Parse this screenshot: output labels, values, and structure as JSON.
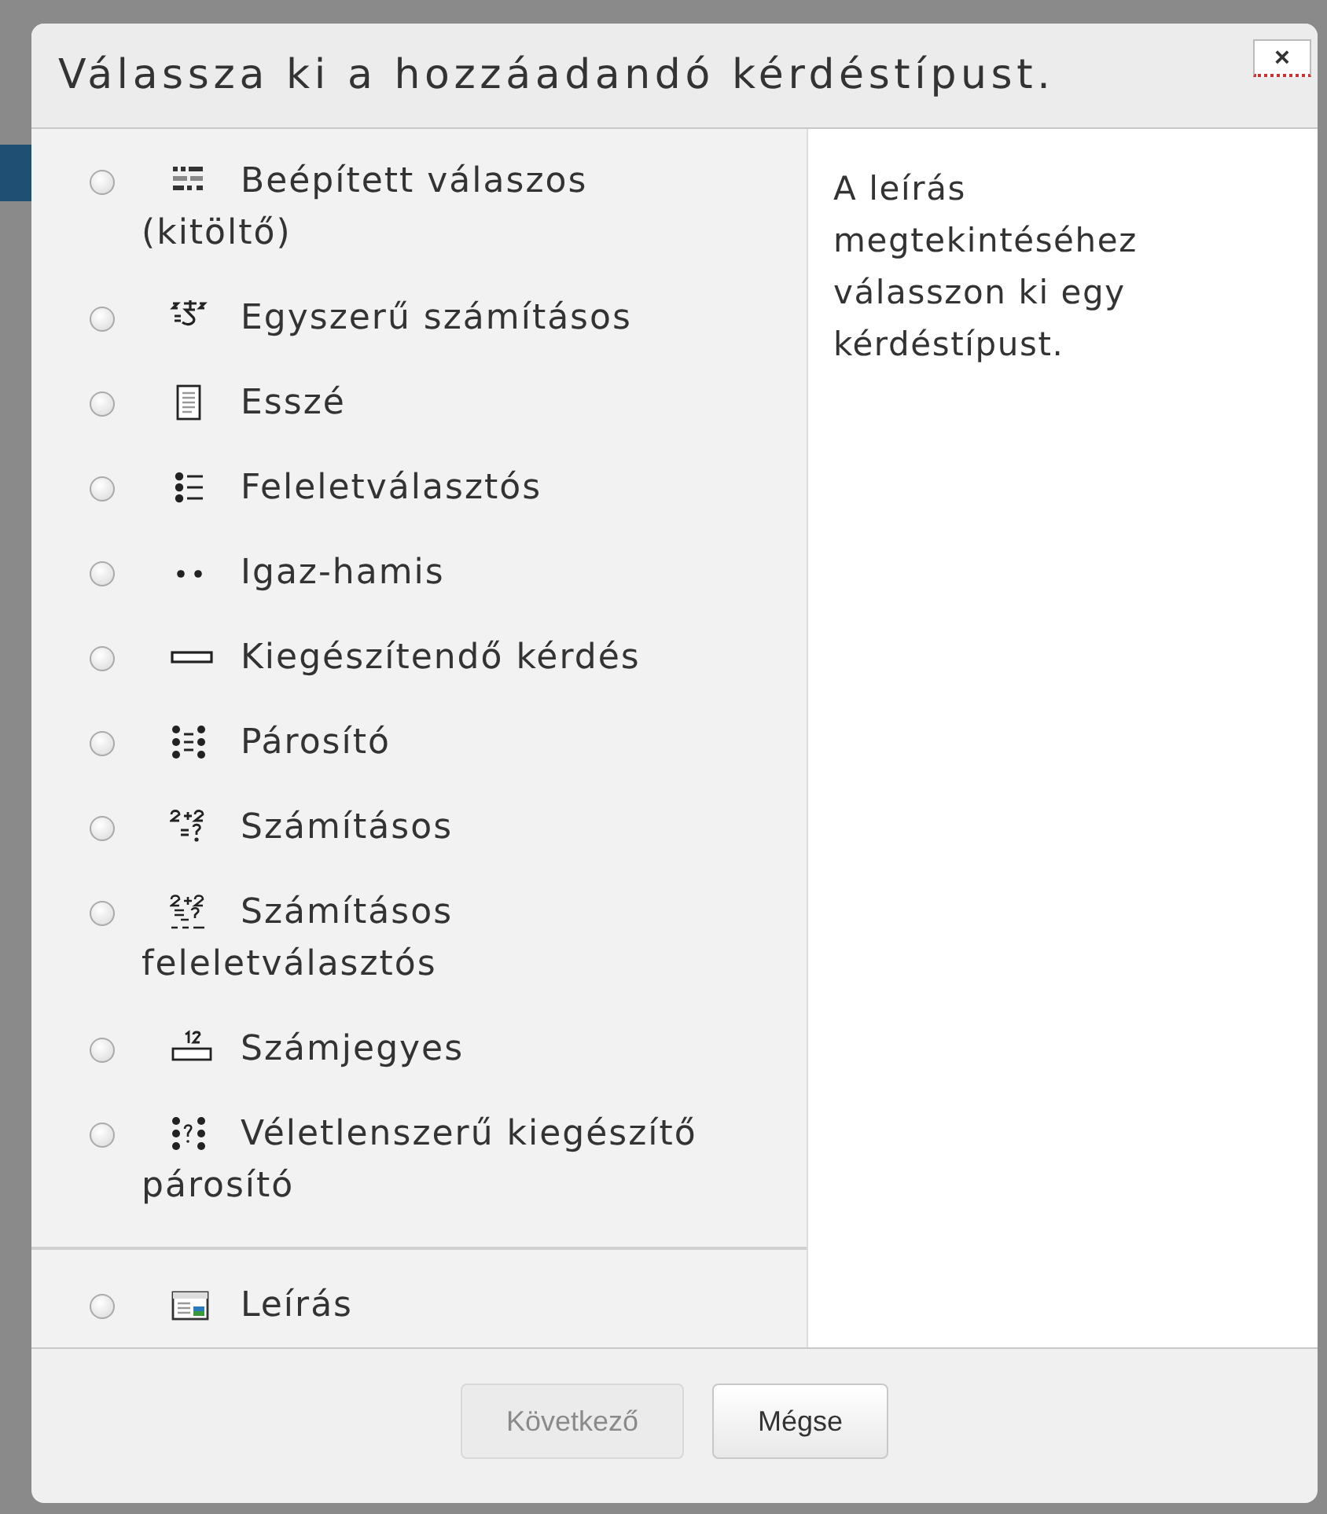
{
  "dialog": {
    "title": "Válassza ki a hozzáadandó kérdéstípust.",
    "close_label": "×"
  },
  "question_types": [
    {
      "kind": "gapselect",
      "label": "Beépített válaszos (kitöltő)",
      "selected": false
    },
    {
      "kind": "calculatedsimple",
      "label": "Egyszerű számításos",
      "selected": false
    },
    {
      "kind": "essay",
      "label": "Esszé",
      "selected": false
    },
    {
      "kind": "multichoice",
      "label": "Feleletválasztós",
      "selected": false
    },
    {
      "kind": "truefalse",
      "label": "Igaz-hamis",
      "selected": false
    },
    {
      "kind": "shortanswer",
      "label": "Kiegészítendő kérdés",
      "selected": false
    },
    {
      "kind": "match",
      "label": "Párosító",
      "selected": false
    },
    {
      "kind": "calculated",
      "label": "Számításos",
      "selected": false
    },
    {
      "kind": "calculatedmulti",
      "label": "Számításos feleletválasztós",
      "selected": false
    },
    {
      "kind": "numerical",
      "label": "Számjegyes",
      "selected": false
    },
    {
      "kind": "randomsamatch",
      "label": "Véletlenszerű kiegészítő párosító",
      "selected": false
    }
  ],
  "other_types": [
    {
      "kind": "description",
      "label": "Leírás",
      "selected": false
    }
  ],
  "description_panel": {
    "text": "A leírás megtekintéséhez válasszon ki egy kérdéstípust."
  },
  "buttons": [
    {
      "label": "Következő",
      "disabled": true
    },
    {
      "label": "Mégse",
      "disabled": false
    }
  ]
}
